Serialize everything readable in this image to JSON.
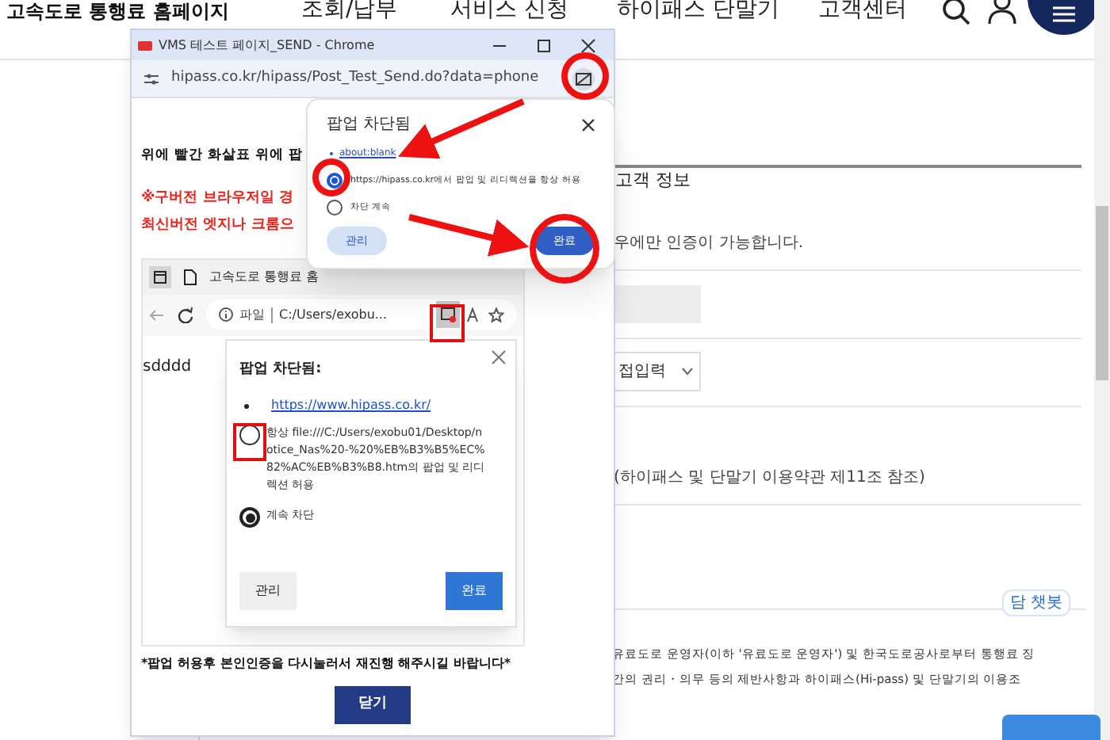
{
  "page": {
    "site_title": "고속도로 통행료 홈페이지",
    "nav": [
      "조회/납부",
      "서비스 신청",
      "하이패스 단말기",
      "고객센터"
    ],
    "section_title": "고객 정보",
    "notice": "우에만 인증이 가능합니다.",
    "select_value": "접입력",
    "terms_note": "(하이패스 및 단말기 이용약관 제11조 참조)",
    "terms_lines": [
      "유료도로 운영자(이하 '유료도로 운영자') 및 한국도로공사로부터 통행료 징",
      "간의 권리・의무 등의 제반사항과 하이패스(Hi-pass) 및 단말기의 이용조"
    ],
    "chat_label": "담 챗봇"
  },
  "popup_window": {
    "title": "VMS 테스트 페이지_SEND - Chrome",
    "url": "hipass.co.kr/hipass/Post_Test_Send.do?data=phone",
    "heading": "위에 빨간 화살표 위에 팝",
    "warning_lines": [
      "※구버전 브라우저일 경",
      "최신버전 엣지나 크롬으"
    ],
    "edge_screenshot": {
      "tab_title": "고속도로 통행료 홈",
      "address_label": "파일",
      "address": "C:/Users/exobu...",
      "page_text": "sdddd",
      "bubble": {
        "title": "팝업 차단됨:",
        "link": "https://www.hipass.co.kr/",
        "options": [
          {
            "label": "항상 file:///C:/Users/exobu01/Desktop/notice_Nas%20-%20%EB%B3%B5%EC%82%AC%EB%B3%B8.htm의 팝업 및 리디렉션 허용",
            "selected": false
          },
          {
            "label": "계속 차단",
            "selected": true
          }
        ],
        "buttons": [
          "관리",
          "완료"
        ]
      }
    },
    "footer_note": "*팝업 허용후 **본인인증**을 다시눌러서 재진행 해주시길 바랍니다*",
    "close_button": "닫기"
  },
  "chrome_bubble": {
    "title": "팝업 차단됨",
    "link": "about:blank",
    "options": [
      {
        "label": "https://hipass.co.kr에서 팝업 및 리디렉션을 항상 허용",
        "selected": true
      },
      {
        "label": "차단 계속",
        "selected": false
      }
    ],
    "buttons": [
      "관리",
      "완료"
    ]
  }
}
